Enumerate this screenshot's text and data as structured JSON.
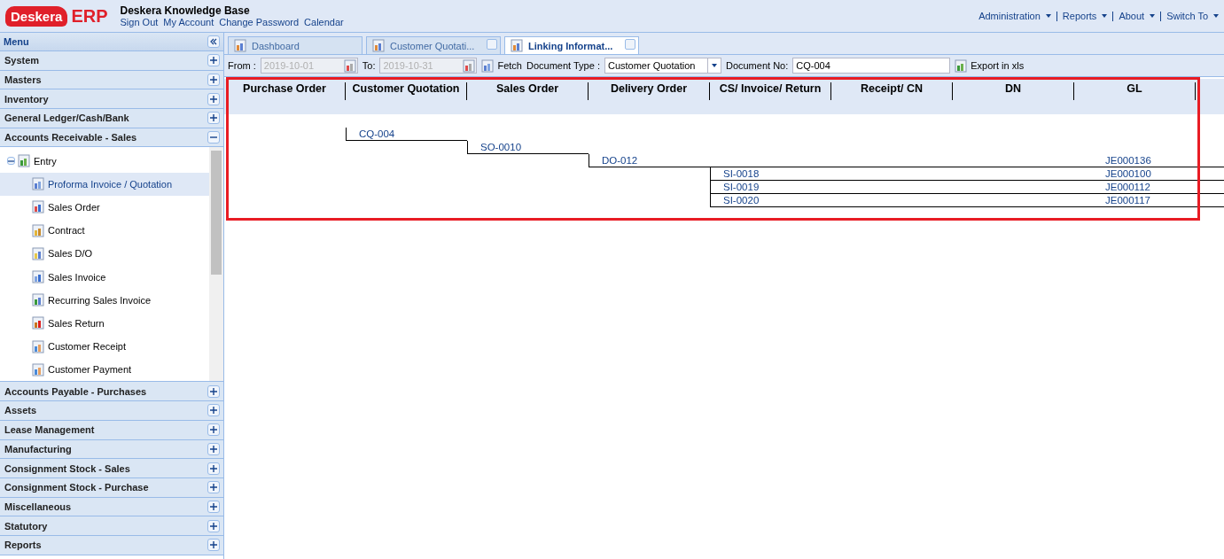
{
  "header": {
    "logo": {
      "brand": "Deskera",
      "product": "ERP"
    },
    "title": "Deskera Knowledge Base",
    "links": [
      "Sign Out",
      "My Account",
      "Change Password",
      "Calendar"
    ],
    "menus": [
      "Administration",
      "Reports",
      "About",
      "Switch To"
    ]
  },
  "sidebar": {
    "title": "Menu",
    "sections": [
      {
        "label": "System",
        "expanded": false
      },
      {
        "label": "Masters",
        "expanded": false
      },
      {
        "label": "Inventory",
        "expanded": false
      },
      {
        "label": "General Ledger/Cash/Bank",
        "expanded": false
      },
      {
        "label": "Accounts Receivable - Sales",
        "expanded": true,
        "tree": {
          "label": "Entry",
          "expanded": true,
          "children": [
            {
              "label": "Proforma Invoice / Quotation",
              "selected": true
            },
            {
              "label": "Sales Order",
              "selected": false
            },
            {
              "label": "Contract",
              "selected": false
            },
            {
              "label": "Sales D/O",
              "selected": false
            },
            {
              "label": "Sales Invoice",
              "selected": false
            },
            {
              "label": "Recurring Sales Invoice",
              "selected": false
            },
            {
              "label": "Sales Return",
              "selected": false
            },
            {
              "label": "Customer Receipt",
              "selected": false
            },
            {
              "label": "Customer Payment",
              "selected": false
            }
          ]
        }
      },
      {
        "label": "Accounts Payable - Purchases",
        "expanded": false
      },
      {
        "label": "Assets",
        "expanded": false
      },
      {
        "label": "Lease Management",
        "expanded": false
      },
      {
        "label": "Manufacturing",
        "expanded": false
      },
      {
        "label": "Consignment Stock - Sales",
        "expanded": false
      },
      {
        "label": "Consignment Stock - Purchase",
        "expanded": false
      },
      {
        "label": "Miscellaneous",
        "expanded": false
      },
      {
        "label": "Statutory",
        "expanded": false
      },
      {
        "label": "Reports",
        "expanded": false
      }
    ]
  },
  "tabs": [
    {
      "label": "Dashboard",
      "selected": false,
      "closable": false
    },
    {
      "label": "Customer Quotati...",
      "selected": false,
      "closable": true
    },
    {
      "label": "Linking Informat...",
      "selected": true,
      "closable": true
    }
  ],
  "toolbar": {
    "from_label": "From :",
    "from": {
      "value": "2019-10-01",
      "disabled": true
    },
    "to_label": "To:",
    "to": {
      "value": "2019-10-31",
      "disabled": true
    },
    "fetch": "Fetch",
    "doc_type_label": "Document Type :",
    "doc_type": "Customer Quotation",
    "doc_no_label": "Document No:",
    "doc_no": "CQ-004",
    "export": "Export in xls"
  },
  "linking": {
    "highlighted": true,
    "columns": [
      "Purchase Order",
      "Customer Quotation",
      "Sales Order",
      "Delivery Order",
      "CS/ Invoice/ Return",
      "Receipt/ CN",
      "DN",
      "GL"
    ],
    "links": [
      {
        "document": "CQ-004",
        "children": [
          {
            "document": "SO-0010",
            "children": [
              {
                "document": "DO-012",
                "gl": "JE000136",
                "children": [
                  {
                    "document": "SI-0018",
                    "gl": "JE000100"
                  },
                  {
                    "document": "SI-0019",
                    "gl": "JE000112"
                  },
                  {
                    "document": "SI-0020",
                    "gl": "JE000117"
                  }
                ]
              }
            ]
          }
        ]
      }
    ]
  }
}
